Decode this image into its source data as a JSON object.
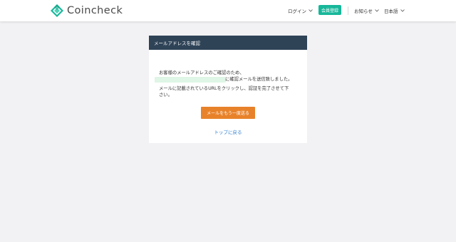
{
  "brand": {
    "name": "Coincheck",
    "accent": "#17b79a"
  },
  "header": {
    "nav": {
      "login": "ログイン",
      "register": "会員登録",
      "news": "お知らせ",
      "language": "日本語"
    }
  },
  "card": {
    "title": "メールアドレスを確認",
    "line1": "お客様のメールアドレスのご確認のため、",
    "line2_suffix": "に確認メールを送信致しました。",
    "line3": "メールに記載されているURLをクリックし、認証を完了させて下",
    "line4": "さい。",
    "resend_button": "メールをもう一度送る",
    "top_link": "トップに戻る"
  },
  "colors": {
    "card_header_bg": "#2f4357",
    "button_bg": "#e8822a",
    "link": "#2f7fd0",
    "page_bg": "#f2f2f4"
  }
}
